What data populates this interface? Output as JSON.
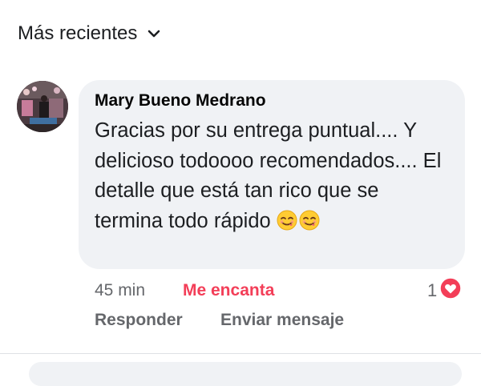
{
  "sort": {
    "label": "Más recientes",
    "icon": "chevron-down-icon"
  },
  "comment": {
    "author": "Mary Bueno Medrano",
    "text": "Gracias por su entrega puntual.... Y delicioso todoooo recomendados.... El detalle que está tan rico que se termina todo rápido",
    "emojis": [
      "smiling-face-savoring-food-emoji",
      "smiling-face-savoring-food-emoji"
    ],
    "time": "45 min",
    "reaction_label": "Me encanta",
    "reaction_count": "1",
    "reaction_icon": "heart-icon",
    "reaction_color": "#f33e58",
    "reply_label": "Responder",
    "message_label": "Enviar mensaje"
  },
  "colors": {
    "bubble": "#f0f2f5",
    "meta_text": "#65676b",
    "love": "#f33e58"
  }
}
